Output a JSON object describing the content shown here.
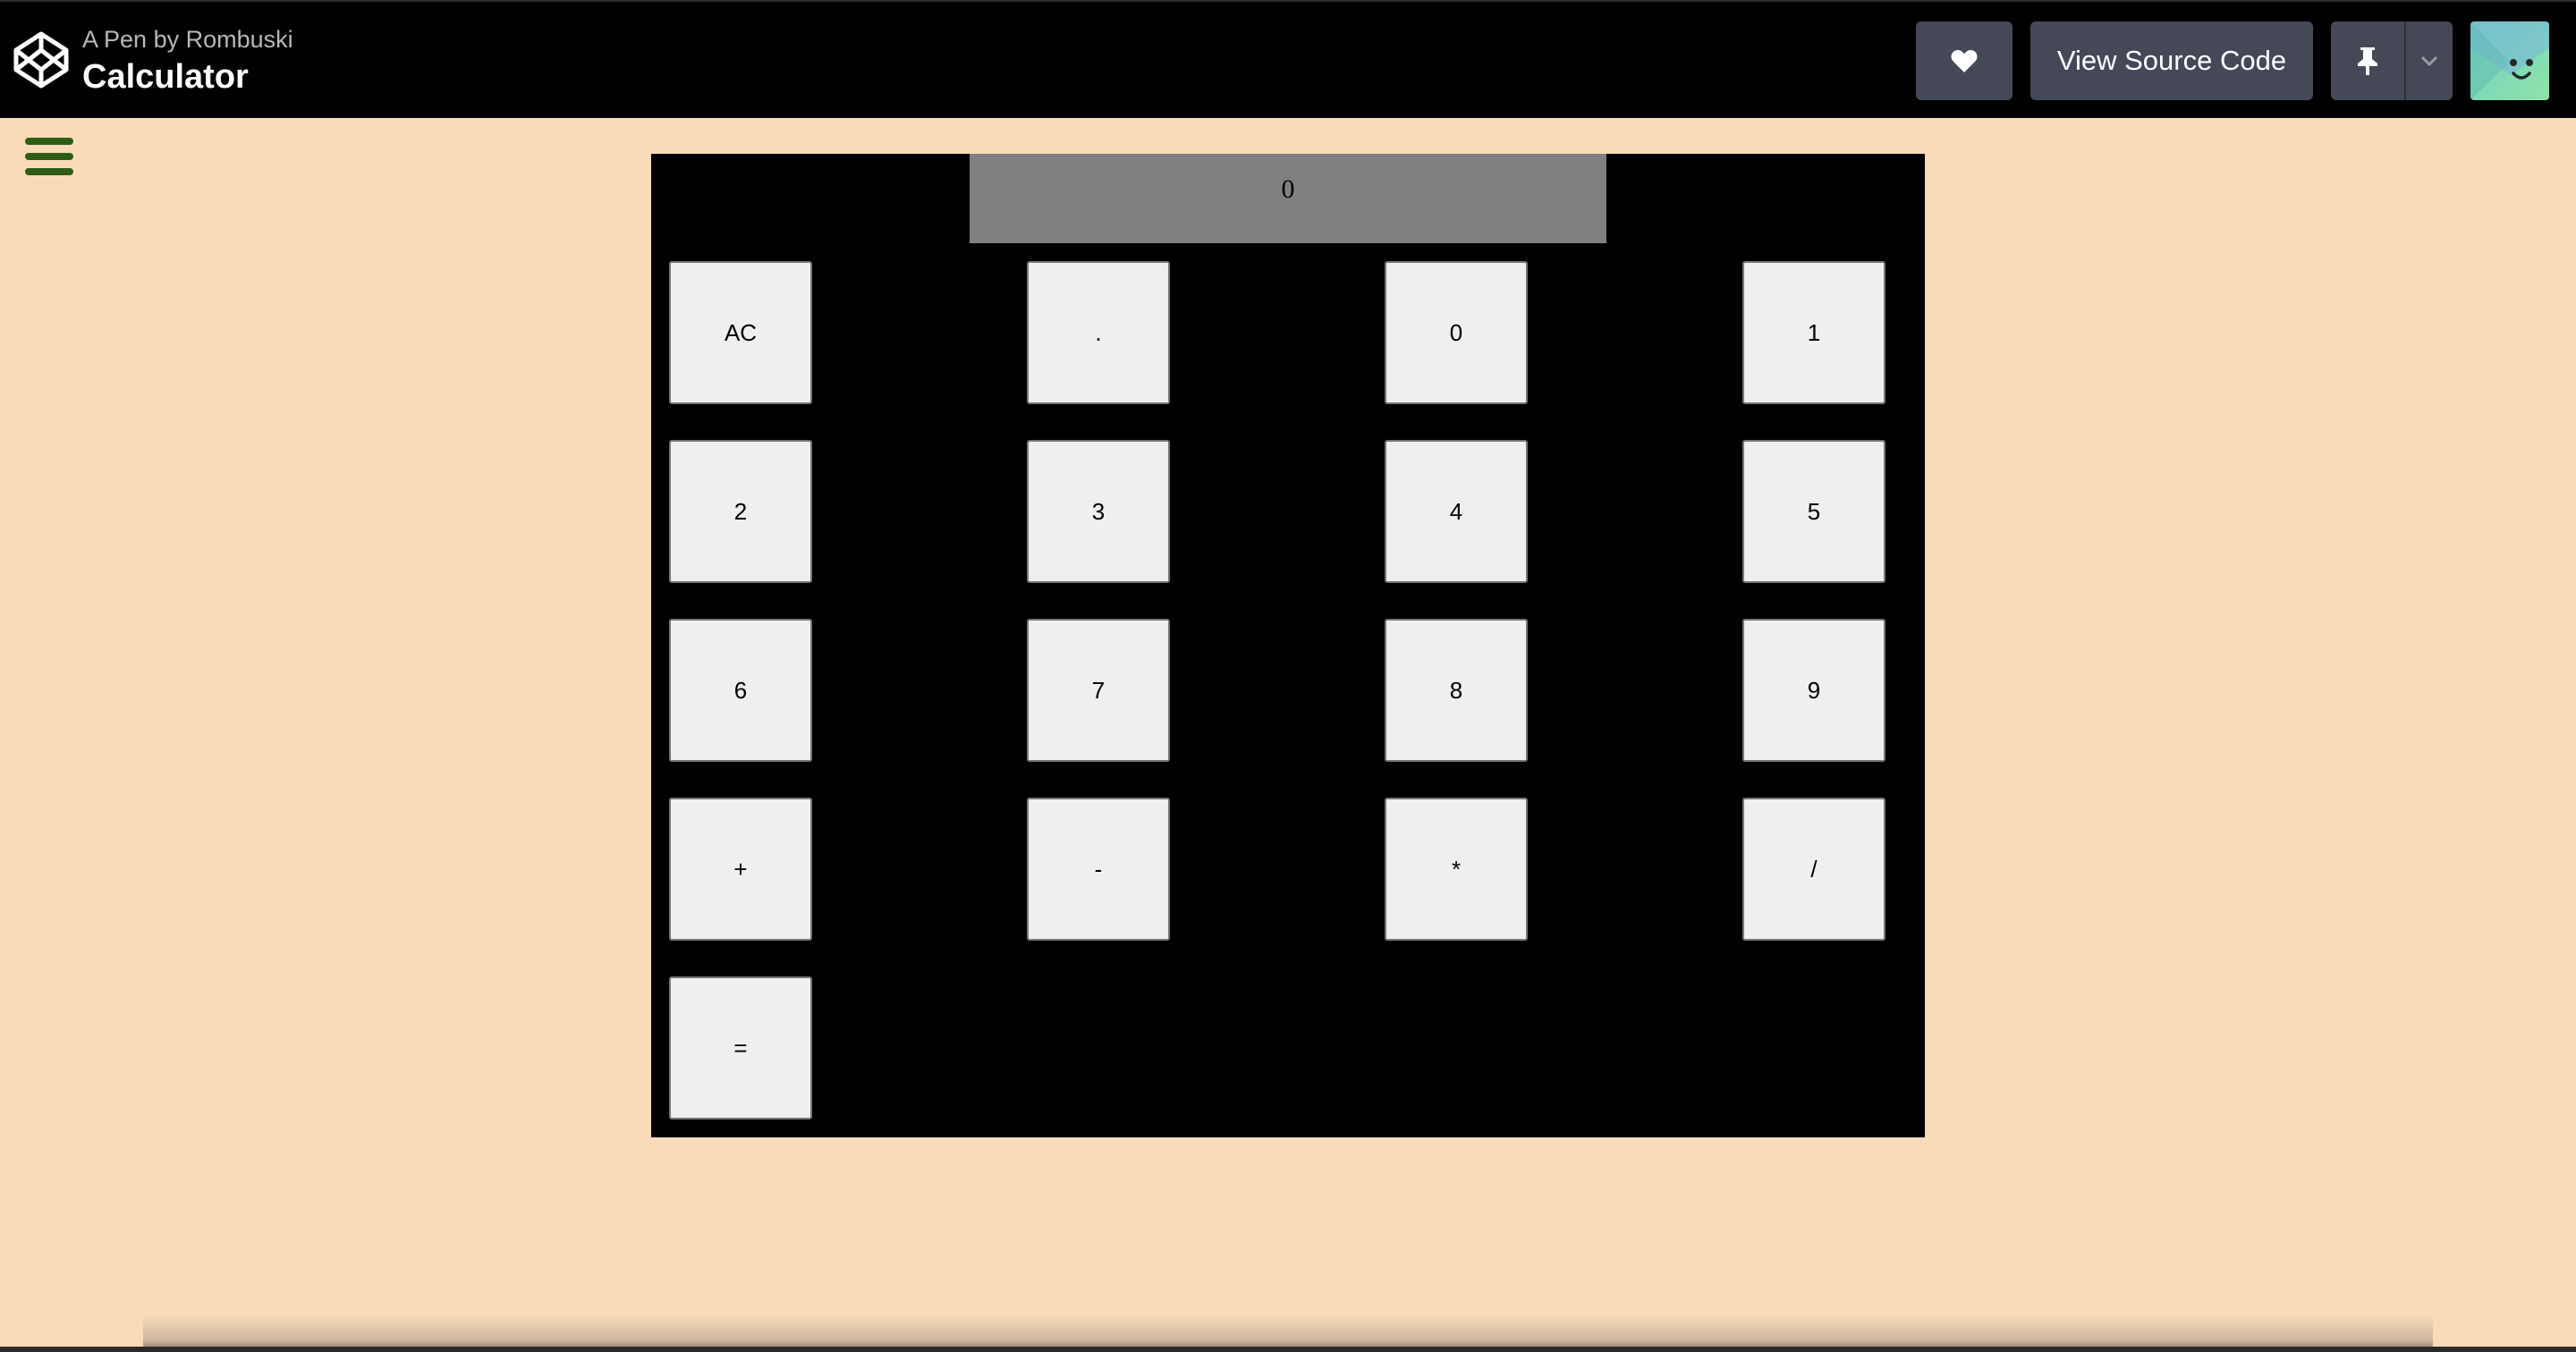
{
  "header": {
    "byline": "A Pen by Rombuski",
    "title": "Calculator",
    "heart_icon": "heart-icon",
    "view_source_label": "View Source Code",
    "pin_icon": "pin-icon",
    "dropdown_icon": "chevron-down-icon",
    "avatar_icon": "avatar-icon"
  },
  "menu": {
    "icon": "hamburger-menu-icon"
  },
  "calculator": {
    "display_value": "0",
    "keys": {
      "ac": "AC",
      "dot": ".",
      "k0": "0",
      "k1": "1",
      "k2": "2",
      "k3": "3",
      "k4": "4",
      "k5": "5",
      "k6": "6",
      "k7": "7",
      "k8": "8",
      "k9": "9",
      "plus": "+",
      "minus": "-",
      "multiply": "*",
      "divide": "/",
      "equals": "="
    }
  },
  "colors": {
    "page_background": "#f9dbb9",
    "topbar_background": "#000000",
    "header_button": "#444857",
    "calculator_background": "#000000",
    "display_background": "#808080",
    "key_background": "#efefef",
    "hamburger": "#2e5e15"
  }
}
